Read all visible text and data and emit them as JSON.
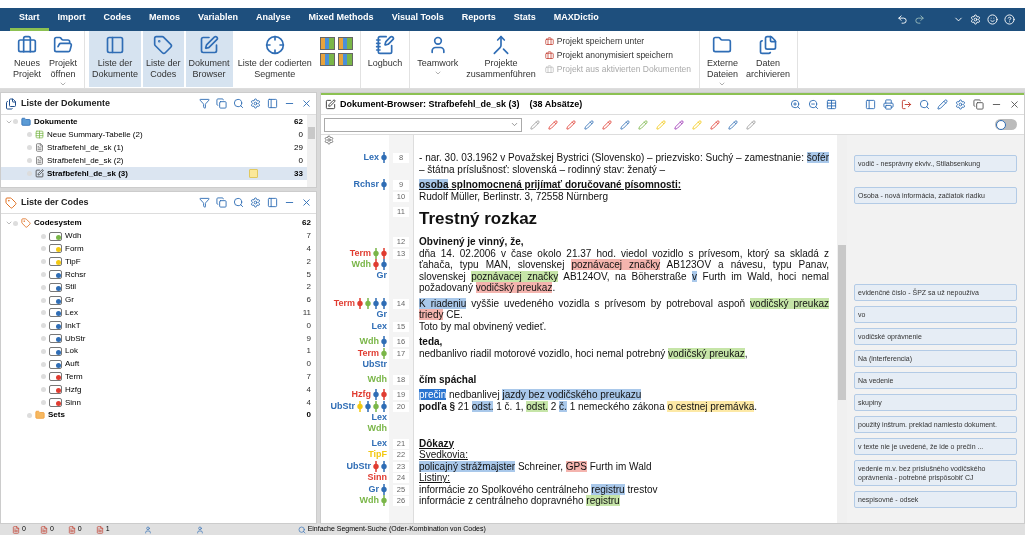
{
  "menu_tabs": [
    {
      "label": "Start",
      "selected": true
    },
    {
      "label": "Import",
      "selected": false
    },
    {
      "label": "Codes",
      "selected": false
    },
    {
      "label": "Memos",
      "selected": false
    },
    {
      "label": "Variablen",
      "selected": false
    },
    {
      "label": "Analyse",
      "selected": false
    },
    {
      "label": "Mixed Methods",
      "selected": false
    },
    {
      "label": "Visual Tools",
      "selected": false
    },
    {
      "label": "Reports",
      "selected": false
    },
    {
      "label": "Stats",
      "selected": false
    },
    {
      "label": "MAXDictio",
      "selected": false
    }
  ],
  "ribbon_groups": [
    {
      "items": [
        {
          "kind": "large",
          "label": "Neues\nProjekt",
          "selected": false,
          "dropdown": false
        },
        {
          "kind": "large",
          "label": "Projekt\nöffnen",
          "selected": false,
          "dropdown": true
        }
      ]
    },
    {
      "items": [
        {
          "kind": "large",
          "label": "Liste der\nDokumente",
          "selected": true,
          "dropdown": false
        },
        {
          "kind": "large",
          "label": "Liste der\nCodes",
          "selected": true,
          "dropdown": false
        },
        {
          "kind": "large",
          "label": "Dokument\nBrowser",
          "selected": true,
          "dropdown": false
        },
        {
          "kind": "large",
          "label": "Liste der codierten\nSegmente",
          "selected": false,
          "dropdown": false
        },
        {
          "kind": "grid"
        }
      ]
    },
    {
      "items": [
        {
          "kind": "large",
          "label": "Logbuch",
          "selected": false,
          "dropdown": false
        }
      ]
    },
    {
      "items": [
        {
          "kind": "large",
          "label": "Teamwork",
          "selected": false,
          "dropdown": true
        },
        {
          "kind": "large",
          "label": "Projekte\nzusammenführen",
          "selected": false,
          "dropdown": false
        },
        {
          "kind": "small_list",
          "entries": [
            {
              "label": "Projekt speichern unter",
              "disabled": false
            },
            {
              "label": "Projekt anonymisiert speichern",
              "disabled": false
            },
            {
              "label": "Projekt aus aktivierten Dokumenten",
              "disabled": true
            }
          ]
        }
      ]
    },
    {
      "items": [
        {
          "kind": "large",
          "label": "Externe\nDateien",
          "selected": false,
          "dropdown": true
        },
        {
          "kind": "large",
          "label": "Daten\narchivieren",
          "selected": false,
          "dropdown": false
        }
      ]
    }
  ],
  "documents_panel": {
    "title": "Liste der Dokumente",
    "root": {
      "name": "Dokumente",
      "count": "62",
      "expanded": true,
      "children": [
        {
          "kind": "table",
          "name": "Neue Summary-Tabelle (2)",
          "count": "0",
          "selected": false,
          "memo": false
        },
        {
          "kind": "text",
          "name": "Strafbefehl_de_sk (1)",
          "count": "29",
          "selected": false,
          "memo": false
        },
        {
          "kind": "text",
          "name": "Strafbefehl_de_sk (2)",
          "count": "0",
          "selected": false,
          "memo": false
        },
        {
          "kind": "edit",
          "name": "Strafbefehl_de_sk (3)",
          "count": "33",
          "selected": true,
          "memo": true
        }
      ]
    }
  },
  "codes_panel": {
    "title": "Liste der Codes",
    "root": {
      "name": "Codesystem",
      "count": "62",
      "expanded": true,
      "children": [
        {
          "name": "Wdh",
          "count": "7",
          "color": "#7ab648"
        },
        {
          "name": "Form",
          "count": "4",
          "color": "#f2c811"
        },
        {
          "name": "TipF",
          "count": "2",
          "color": "#f2c811"
        },
        {
          "name": "Rchsr",
          "count": "5",
          "color": "#2f6db5"
        },
        {
          "name": "Stil",
          "count": "2",
          "color": "#2f6db5"
        },
        {
          "name": "Gr",
          "count": "6",
          "color": "#2f6db5"
        },
        {
          "name": "Lex",
          "count": "11",
          "color": "#2f6db5"
        },
        {
          "name": "InkT",
          "count": "0",
          "color": "#2f6db5"
        },
        {
          "name": "UbStr",
          "count": "9",
          "color": "#2f6db5"
        },
        {
          "name": "Lok",
          "count": "1",
          "color": "#2f6db5"
        },
        {
          "name": "Auft",
          "count": "0",
          "color": "#2f6db5"
        },
        {
          "name": "Term",
          "count": "7",
          "color": "#e03c31"
        },
        {
          "name": "Hzfg",
          "count": "4",
          "color": "#e03c31"
        },
        {
          "name": "Sinn",
          "count": "4",
          "color": "#e03c31"
        }
      ]
    },
    "sets": {
      "name": "Sets",
      "count": "0"
    }
  },
  "browser": {
    "title": "Dokument-Browser: Strafbefehl_de_sk (3)",
    "paragraph_count": "(38 Absätze)",
    "memo_toggle": {
      "on": false
    },
    "blocks": [
      [
        {
          "number": "8",
          "kind": "normal",
          "codes": [
            {
              "name": "Lex",
              "color": "#2f6db5",
              "stripes": [
                {
                  "color": "#2f6db5"
                }
              ]
            }
          ],
          "segments": [
            {
              "text": "- nar. 30. 03.1962 v Považskej Bystrici (Slovensko) – priezvisko: Suchý – zamestnanie: "
            },
            {
              "text": "šofér",
              "color": "#a9c8ea"
            },
            {
              "text": " – štátna príslušnosť: slovenská – rodinný stav: ženatý –"
            }
          ]
        }
      ],
      [
        {
          "number": "9",
          "kind": "bold_underline",
          "codes": [
            {
              "name": "Rchsr",
              "color": "#2f6db5",
              "stripes": [
                {
                  "color": "#2f6db5"
                }
              ]
            }
          ],
          "segments": [
            {
              "text": "osoba",
              "color": "#a9c8ea"
            },
            {
              "text": " splnomocnená prijímať doručované písomnosti:"
            }
          ]
        },
        {
          "number": "10",
          "kind": "normal",
          "segments": [
            {
              "text": "Rudolf Müller, Berlinstr. 3, 72558 Nürnberg"
            }
          ]
        }
      ],
      [
        {
          "number": "11",
          "kind": "heading",
          "segments": [
            {
              "text": "Trestný rozkaz"
            }
          ]
        }
      ],
      [
        {
          "number": "12",
          "kind": "bold",
          "segments": [
            {
              "text": "Obvinený je vinný, že,"
            }
          ]
        },
        {
          "number": "13",
          "kind": "normal",
          "codes": [
            {
              "name": "Term",
              "color": "#e03c31",
              "stripes": [
                {
                  "color": "#7ab648"
                },
                {
                  "color": "#e03c31"
                }
              ]
            },
            {
              "name": "Wdh",
              "color": "#7ab648",
              "stripes": [
                {
                  "color": "#e03c31"
                },
                {
                  "color": "#2f6db5"
                }
              ]
            },
            {
              "name": "Gr",
              "color": "#2f6db5"
            }
          ],
          "segments": [
            {
              "text": "dňa 14. 02.2006 v čase okolo 21.37 hod. viedol vozidlo s prívesom, ktorý sa skladá z ťahača, typu MAN, slovenskej "
            },
            {
              "text": "poznávacej značky",
              "color": "#f4b4ae"
            },
            {
              "text": " AB123OV a návesu, typu Panav, slovenskej "
            },
            {
              "text": "poznávacej značky",
              "color": "#c6e5a8"
            },
            {
              "text": " AB124OV, na Böherstraße "
            },
            {
              "text": "v",
              "color": "#a9c8ea"
            },
            {
              "text": " Furth im Wald, hoci nemal požadovaný "
            },
            {
              "text": "vodičský preukaz",
              "color": "#f4b4ae"
            },
            {
              "text": "."
            }
          ]
        }
      ],
      [
        {
          "number": "14",
          "kind": "normal",
          "codes": [
            {
              "name": "Term",
              "color": "#e03c31",
              "stripes": [
                {
                  "color": "#e03c31"
                },
                {
                  "color": "#7ab648"
                },
                {
                  "color": "#2f6db5"
                },
                {
                  "color": "#2f6db5"
                }
              ]
            },
            {
              "name": "Gr",
              "color": "#2f6db5"
            }
          ],
          "segments": [
            {
              "text": "K riadeniu",
              "color": "#a9c8ea"
            },
            {
              "text": " vyššie uvedeného vozidla s prívesom by potreboval aspoň "
            },
            {
              "text": "vodičský preukaz ",
              "color": "#c6e5a8"
            },
            {
              "text": "triedy",
              "color": "#f4b4ae"
            },
            {
              "text": " CE."
            }
          ]
        },
        {
          "number": "15",
          "kind": "normal",
          "codes": [
            {
              "name": "Lex",
              "color": "#2f6db5"
            }
          ],
          "segments": [
            {
              "text": "Toto by mal obvinený vedieť."
            }
          ]
        }
      ],
      [
        {
          "number": "16",
          "kind": "bold",
          "codes": [
            {
              "name": "Wdh",
              "color": "#7ab648",
              "stripes": [
                {
                  "color": "#2f6db5"
                }
              ]
            }
          ],
          "segments": [
            {
              "text": "teda,"
            }
          ]
        },
        {
          "number": "17",
          "kind": "normal",
          "codes": [
            {
              "name": "Term",
              "color": "#e03c31",
              "stripes": [
                {
                  "color": "#7ab648"
                }
              ]
            },
            {
              "name": "UbStr",
              "color": "#2f6db5"
            }
          ],
          "segments": [
            {
              "text": "nedbanlivo riadil motorové vozidlo, hoci nemal potrebný "
            },
            {
              "text": "vodičský preukaz",
              "color": "#c6e5a8"
            },
            {
              "text": ","
            }
          ]
        }
      ],
      [
        {
          "number": "18",
          "kind": "bold",
          "codes": [
            {
              "name": "Wdh",
              "color": "#7ab648"
            }
          ],
          "segments": [
            {
              "text": "čím spáchal"
            }
          ]
        }
      ],
      [
        {
          "number": "19",
          "kind": "normal",
          "codes": [
            {
              "name": "Hzfg",
              "color": "#e03c31",
              "stripes": [
                {
                  "color": "#2f6db5"
                },
                {
                  "color": "#e03c31"
                }
              ]
            }
          ],
          "segments": [
            {
              "text": "prečin",
              "color": "#2a74d0"
            },
            {
              "text": " nedbanlivej "
            },
            {
              "text": "jazdy bez vodičského preukazu",
              "color": "#a9c8ea"
            }
          ]
        },
        {
          "number": "20",
          "kind": "normal",
          "codes": [
            {
              "name": "UbStr",
              "color": "#2f6db5",
              "stripes": [
                {
                  "color": "#f2c811"
                },
                {
                  "color": "#2f6db5"
                },
                {
                  "color": "#7ab648"
                },
                {
                  "color": "#2f6db5"
                }
              ]
            },
            {
              "name": "Lex",
              "color": "#2f6db5"
            },
            {
              "name": "Wdh",
              "color": "#7ab648"
            }
          ],
          "segments": [
            {
              "text": "podľa §",
              "bold": true
            },
            {
              "text": " 21 "
            },
            {
              "text": "odst.",
              "color": "#a9c8ea"
            },
            {
              "text": " 1 č. 1, "
            },
            {
              "text": "odst.",
              "color": "#c6e5a8"
            },
            {
              "text": " 2 "
            },
            {
              "text": "č.",
              "color": "#a9c8ea"
            },
            {
              "text": " 1 nemeckého zákona "
            },
            {
              "text": "o cestnej premávka",
              "color": "#fde9a6"
            },
            {
              "text": "."
            }
          ]
        }
      ],
      [
        {
          "number": "21",
          "kind": "bold_underline",
          "codes": [
            {
              "name": "Lex",
              "color": "#2f6db5"
            }
          ],
          "segments": [
            {
              "text": "Dôkazy"
            }
          ]
        },
        {
          "number": "22",
          "kind": "underline",
          "codes": [
            {
              "name": "TipF",
              "color": "#f2c811"
            }
          ],
          "segments": [
            {
              "text": "Svedkovia:"
            }
          ]
        },
        {
          "number": "23",
          "kind": "normal",
          "codes": [
            {
              "name": "UbStr",
              "color": "#2f6db5",
              "stripes": [
                {
                  "color": "#e03c31"
                },
                {
                  "color": "#2f6db5"
                }
              ]
            }
          ],
          "segments": [
            {
              "text": "policajný strážmajster",
              "color": "#a9c8ea"
            },
            {
              "text": " Schreiner, "
            },
            {
              "text": "GPS",
              "color": "#f4b4ae"
            },
            {
              "text": " Furth im Wald"
            }
          ]
        },
        {
          "number": "24",
          "kind": "underline",
          "codes": [
            {
              "name": "Sinn",
              "color": "#e03c31"
            }
          ],
          "segments": [
            {
              "text": "Listiny:"
            }
          ]
        },
        {
          "number": "25",
          "kind": "normal",
          "codes": [
            {
              "name": "Gr",
              "color": "#2f6db5",
              "stripes": [
                {
                  "color": "#2f6db5"
                }
              ]
            }
          ],
          "segments": [
            {
              "text": "informácie zo Spolkového centrálneho "
            },
            {
              "text": "registru",
              "color": "#a9c8ea"
            },
            {
              "text": " trestov"
            }
          ]
        },
        {
          "number": "26",
          "kind": "normal",
          "codes": [
            {
              "name": "Wdh",
              "color": "#7ab648",
              "stripes": [
                {
                  "color": "#7ab648"
                }
              ]
            }
          ],
          "segments": [
            {
              "text": "informácie z centrálneho dopravného "
            },
            {
              "text": "registru",
              "color": "#c6e5a8"
            }
          ]
        }
      ]
    ]
  },
  "memo_groups": [
    [
      "vodič - nesprávny ekviv., Stilabsenkung",
      "Osoba -  nová informácia, začiatok riadku"
    ],
    [
      "evidenčné číslo - ŠPZ sa už nepoužíva",
      "vo",
      "vodičské oprávnenie",
      "Na (interferencia)",
      "Na vedenie",
      "skupiny",
      "použitý inštrum. preklad namiesto dokument.",
      "v texte nie je uvedené, že ide o prečin ...",
      "vedenie m.v. bez príslušného vodičského oprávnenia - potrebné prispôsobiť CJ",
      "nespisovné - odsek"
    ]
  ],
  "status_bar": {
    "counts": [
      "0",
      "0",
      "0",
      "1"
    ],
    "search_mode": "Einfache Segment-Suche (Oder-Kombination von Codes)"
  }
}
